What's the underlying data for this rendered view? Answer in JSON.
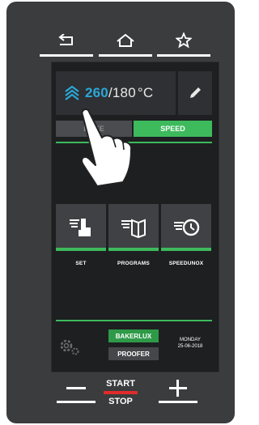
{
  "top_bar": {
    "back_icon": "back-arrow-icon",
    "home_icon": "home-icon",
    "favorite_icon": "star-icon"
  },
  "temperature": {
    "current": "260",
    "separator": "/",
    "target": "180",
    "unit": "°C"
  },
  "tabs": {
    "bake": "BAKE",
    "speed": "SPEED"
  },
  "functions": [
    {
      "label": "SET",
      "icon": "set-hand-icon"
    },
    {
      "label": "PROGRAMS",
      "icon": "programs-book-icon"
    },
    {
      "label": "SPEEDUNOX",
      "icon": "speedunox-clock-icon"
    }
  ],
  "modes": {
    "bakerlux": "BAKERLUX",
    "proofer": "PROOFER"
  },
  "date": {
    "weekday": "MONDAY",
    "date": "25-06-2018"
  },
  "bottom_bar": {
    "minus": "−",
    "start": "START",
    "stop": "STOP",
    "plus": "+"
  },
  "colors": {
    "accent_green": "#3dba5c",
    "accent_blue": "#2ba7d8",
    "start_red": "#e02b2b",
    "panel": "#3a3c3e",
    "screen": "#1e1f21"
  }
}
